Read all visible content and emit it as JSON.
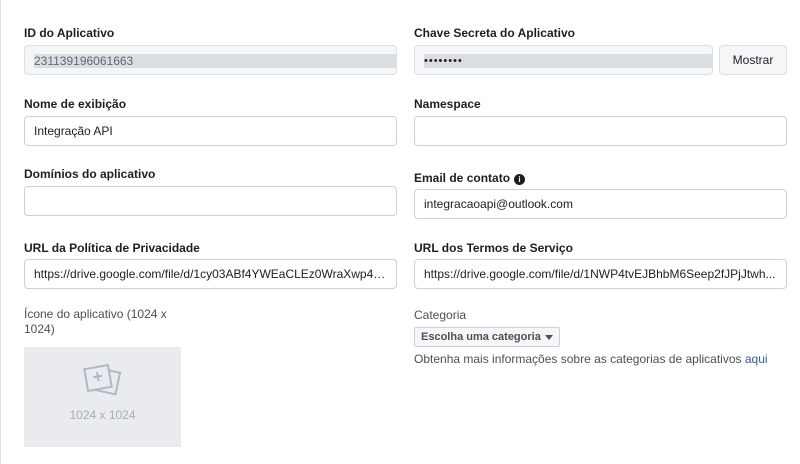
{
  "app_id": {
    "label": "ID do Aplicativo",
    "value": "231139196061663"
  },
  "app_secret": {
    "label": "Chave Secreta do Aplicativo",
    "value": "••••••••",
    "show_button": "Mostrar"
  },
  "display_name": {
    "label": "Nome de exibição",
    "value": "Integração API"
  },
  "namespace": {
    "label": "Namespace",
    "value": ""
  },
  "app_domains": {
    "label": "Domínios do aplicativo",
    "value": ""
  },
  "contact_email": {
    "label": "Email de contato",
    "info_icon": "info-icon",
    "value": "integracaoapi@outlook.com"
  },
  "privacy_policy_url": {
    "label": "URL da Política de Privacidade",
    "value": "https://drive.google.com/file/d/1cy03ABf4YWEaCLEz0WraXwp4Q..."
  },
  "terms_url": {
    "label": "URL dos Termos de Serviço",
    "value": "https://drive.google.com/file/d/1NWP4tvEJBhbM6Seep2fJPjJtwh..."
  },
  "app_icon": {
    "label": "Ícone do aplicativo (1024 x 1024)",
    "size_text": "1024 x 1024",
    "icon": "image-placeholder-icon"
  },
  "category": {
    "label": "Categoria",
    "dropdown": "Escolha uma categoria",
    "help_text": "Obtenha mais informações sobre as categorias de aplicativos",
    "help_link": "aqui"
  },
  "colors": {
    "link": "#385898",
    "border": "#ccd0d5",
    "readonly_bg": "#f5f6f7"
  }
}
